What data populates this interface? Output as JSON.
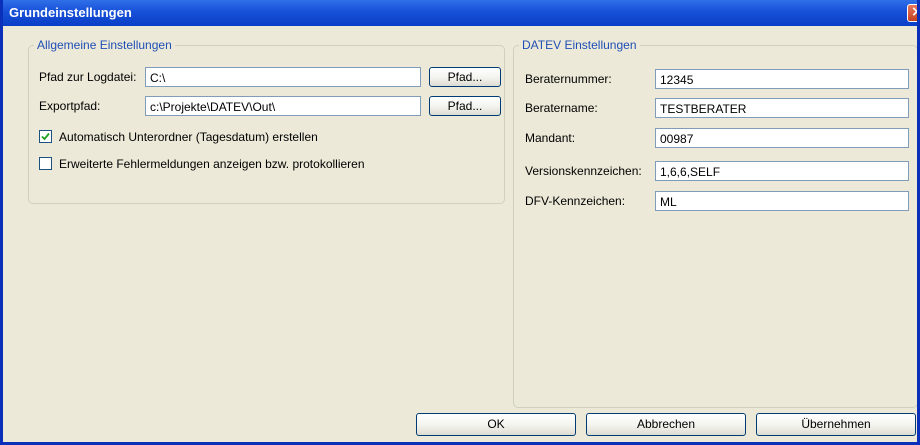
{
  "window": {
    "title": "Grundeinstellungen",
    "close_icon": "close-icon"
  },
  "general": {
    "legend": "Allgemeine Einstellungen",
    "log_path": {
      "label": "Pfad zur Logdatei:",
      "value": "C:\\",
      "button": "Pfad..."
    },
    "export_path": {
      "label": "Exportpfad:",
      "value": "c:\\Projekte\\DATEV\\Out\\",
      "button": "Pfad..."
    },
    "auto_subfolder": {
      "label": "Automatisch Unterordner (Tagesdatum) erstellen",
      "checked": true
    },
    "extended_errors": {
      "label": "Erweiterte Fehlermeldungen anzeigen bzw. protokollieren",
      "checked": false
    }
  },
  "datev": {
    "legend": "DATEV Einstellungen",
    "fields": [
      {
        "label": "Beraternummer:",
        "value": "12345"
      },
      {
        "label": "Beratername:",
        "value": "TESTBERATER"
      },
      {
        "label": "Mandant:",
        "value": "00987"
      },
      {
        "label": "Versionskennzeichen:",
        "value": "1,6,6,SELF"
      },
      {
        "label": "DFV-Kennzeichen:",
        "value": "ML"
      }
    ]
  },
  "buttons": {
    "ok": "OK",
    "cancel": "Abbrechen",
    "apply": "Übernehmen"
  },
  "colors": {
    "titlebar": "#0a3ec6",
    "dialog_background": "#ece9d8",
    "legend_text": "#1f4fb6",
    "input_border": "#7f9db9"
  }
}
